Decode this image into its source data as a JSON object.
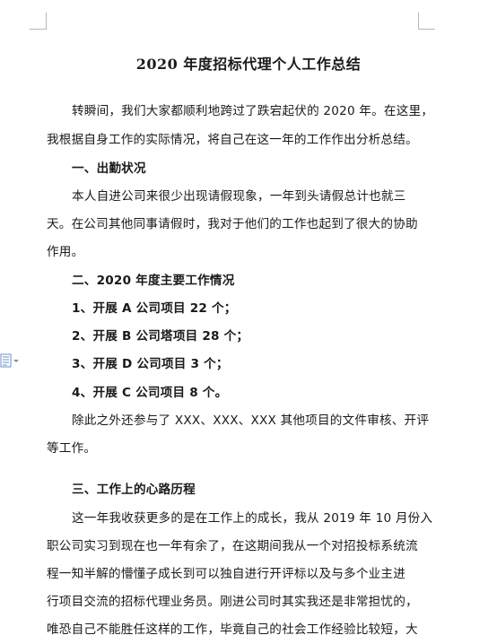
{
  "document": {
    "title": "2020 年度招标代理个人工作总结",
    "lines": [
      "转瞬间，我们大家都顺利地跨过了跌宕起伏的 2020 年。在这里，",
      "我根据自身工作的实际情况，将自己在这一年的工作作出分析总结。",
      "一、出勤状况",
      "本人自进公司来很少出现请假现象，一年到头请假总计也就三",
      "天。在公司其他同事请假时，我对于他们的工作也起到了很大的协助",
      "作用。",
      "二、2020 年度主要工作情况",
      "1、开展 A 公司项目 22 个；",
      "2、开展 B 公司塔项目 28 个；",
      "3、开展 D 公司项目 3 个；",
      "4、开展 C 公司项目 8 个。",
      "除此之外还参与了 XXX、XXX、XXX 其他项目的文件审核、开评",
      "等工作。",
      "三、工作上的心路历程",
      "这一年我收获更多的是在工作上的成长，我从 2019 年 10 月份入",
      "职公司实习到现在也一年有余了，在这期间我从一个对招投标系统流",
      "程一知半解的懵懂子成长到可以独自进行开评标以及与多个业主进",
      "行项目交流的招标代理业务员。刚进公司时其实我还是非常担忧的，",
      "唯恐自己不能胜任这样的工作，毕竟自己的社会工作经验比较短，大"
    ]
  }
}
